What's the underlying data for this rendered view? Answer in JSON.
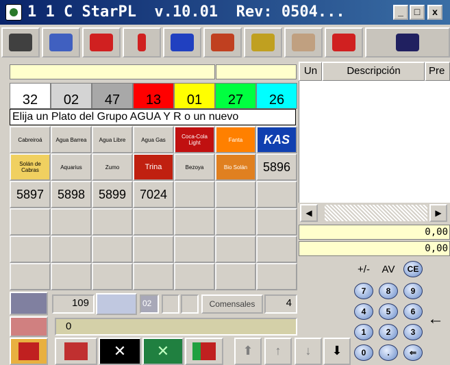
{
  "window": {
    "title": "1 1 C StarPL  v.10.01  Rev: 0504...",
    "minimize": "_",
    "maximize": "□",
    "close": "x"
  },
  "toolbar": {
    "buttons": [
      {
        "name": "login-icon",
        "color": "#404040"
      },
      {
        "name": "exchange-icon",
        "color": "#4060c0"
      },
      {
        "name": "gift-icon",
        "color": "#d02020"
      },
      {
        "name": "alert-icon",
        "color": "#d02020"
      },
      {
        "name": "glass-icon",
        "color": "#2040c0"
      },
      {
        "name": "first-course-icon",
        "color": "#c04020"
      },
      {
        "name": "second-course-icon",
        "color": "#c0a020"
      },
      {
        "name": "dessert-icon",
        "color": "#c0a080"
      },
      {
        "name": "menu-icon",
        "color": "#d02020"
      },
      {
        "name": "book-icon",
        "color": "#202060"
      }
    ]
  },
  "groups": {
    "tabs": [
      {
        "label": "32",
        "color": "#ffffff"
      },
      {
        "label": "02",
        "color": "#d4d4d4"
      },
      {
        "label": "47",
        "color": "#a8a8a8"
      },
      {
        "label": "13",
        "color": "#ff0000"
      },
      {
        "label": "01",
        "color": "#ffff00"
      },
      {
        "label": "27",
        "color": "#00ff40"
      },
      {
        "label": "26",
        "color": "#00ffff"
      }
    ],
    "prompt": "Elija un Plato del Grupo AGUA Y R o un nuevo"
  },
  "products": {
    "row1": [
      "Cabreiroá",
      "Agua Barrea",
      "Agua Libre",
      "Agua Gas",
      "Coca-Cola Light",
      "Fanta",
      "KAS"
    ],
    "row2": [
      "Solán de Cabras",
      "Aquarius",
      "Zumo",
      "Trina",
      "Bezoya",
      "Bio Solán",
      "5896"
    ],
    "row3": [
      "5897",
      "5898",
      "5899",
      "7024"
    ]
  },
  "order": {
    "columns": [
      "Un",
      "Descripción",
      "Pre"
    ],
    "total1": "0,00",
    "total2": "0,00"
  },
  "keypad": {
    "ops": [
      "+/-",
      "AV",
      "CE"
    ],
    "digits": [
      "7",
      "8",
      "9",
      "4",
      "5",
      "6",
      "1",
      "2",
      "3",
      "0",
      "."
    ],
    "enter_arrow": "←"
  },
  "bottom": {
    "table_number": "109",
    "field_small": "02",
    "comensales_label": "Comensales",
    "comensales_value": "4",
    "input_value": "0",
    "arrows": [
      "⬆",
      "↑",
      "↓",
      "⬇"
    ]
  }
}
